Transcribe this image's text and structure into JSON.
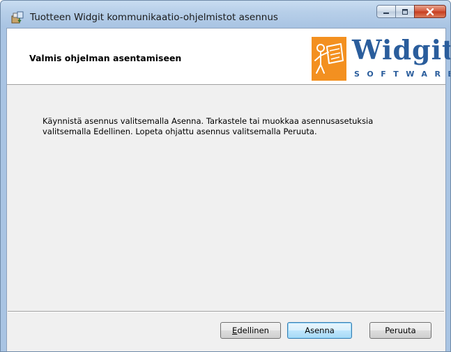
{
  "window": {
    "title": "Tuotteen Widgit kommunikaatio-ohjelmistot asennus",
    "caption_buttons": {
      "minimize_icon": "minimize-icon",
      "maximize_icon": "maximize-icon",
      "close_icon": "close-icon"
    }
  },
  "banner": {
    "title": "Valmis ohjelman asentamiseen",
    "logo": {
      "word": "Widgit",
      "sub": "SOFTWARE",
      "brand_color": "#2a5d9c",
      "mark_color": "#f39020"
    }
  },
  "body": {
    "line1": "Käynnistä asennus valitsemalla Asenna. Tarkastele tai muokkaa asennusasetuksia",
    "line2": "valitsemalla Edellinen. Lopeta ohjattu asennus valitsemalla Peruuta."
  },
  "buttons": {
    "back": {
      "mnemonic": "E",
      "rest": "dellinen"
    },
    "install": "Asenna",
    "cancel": "Peruuta"
  }
}
